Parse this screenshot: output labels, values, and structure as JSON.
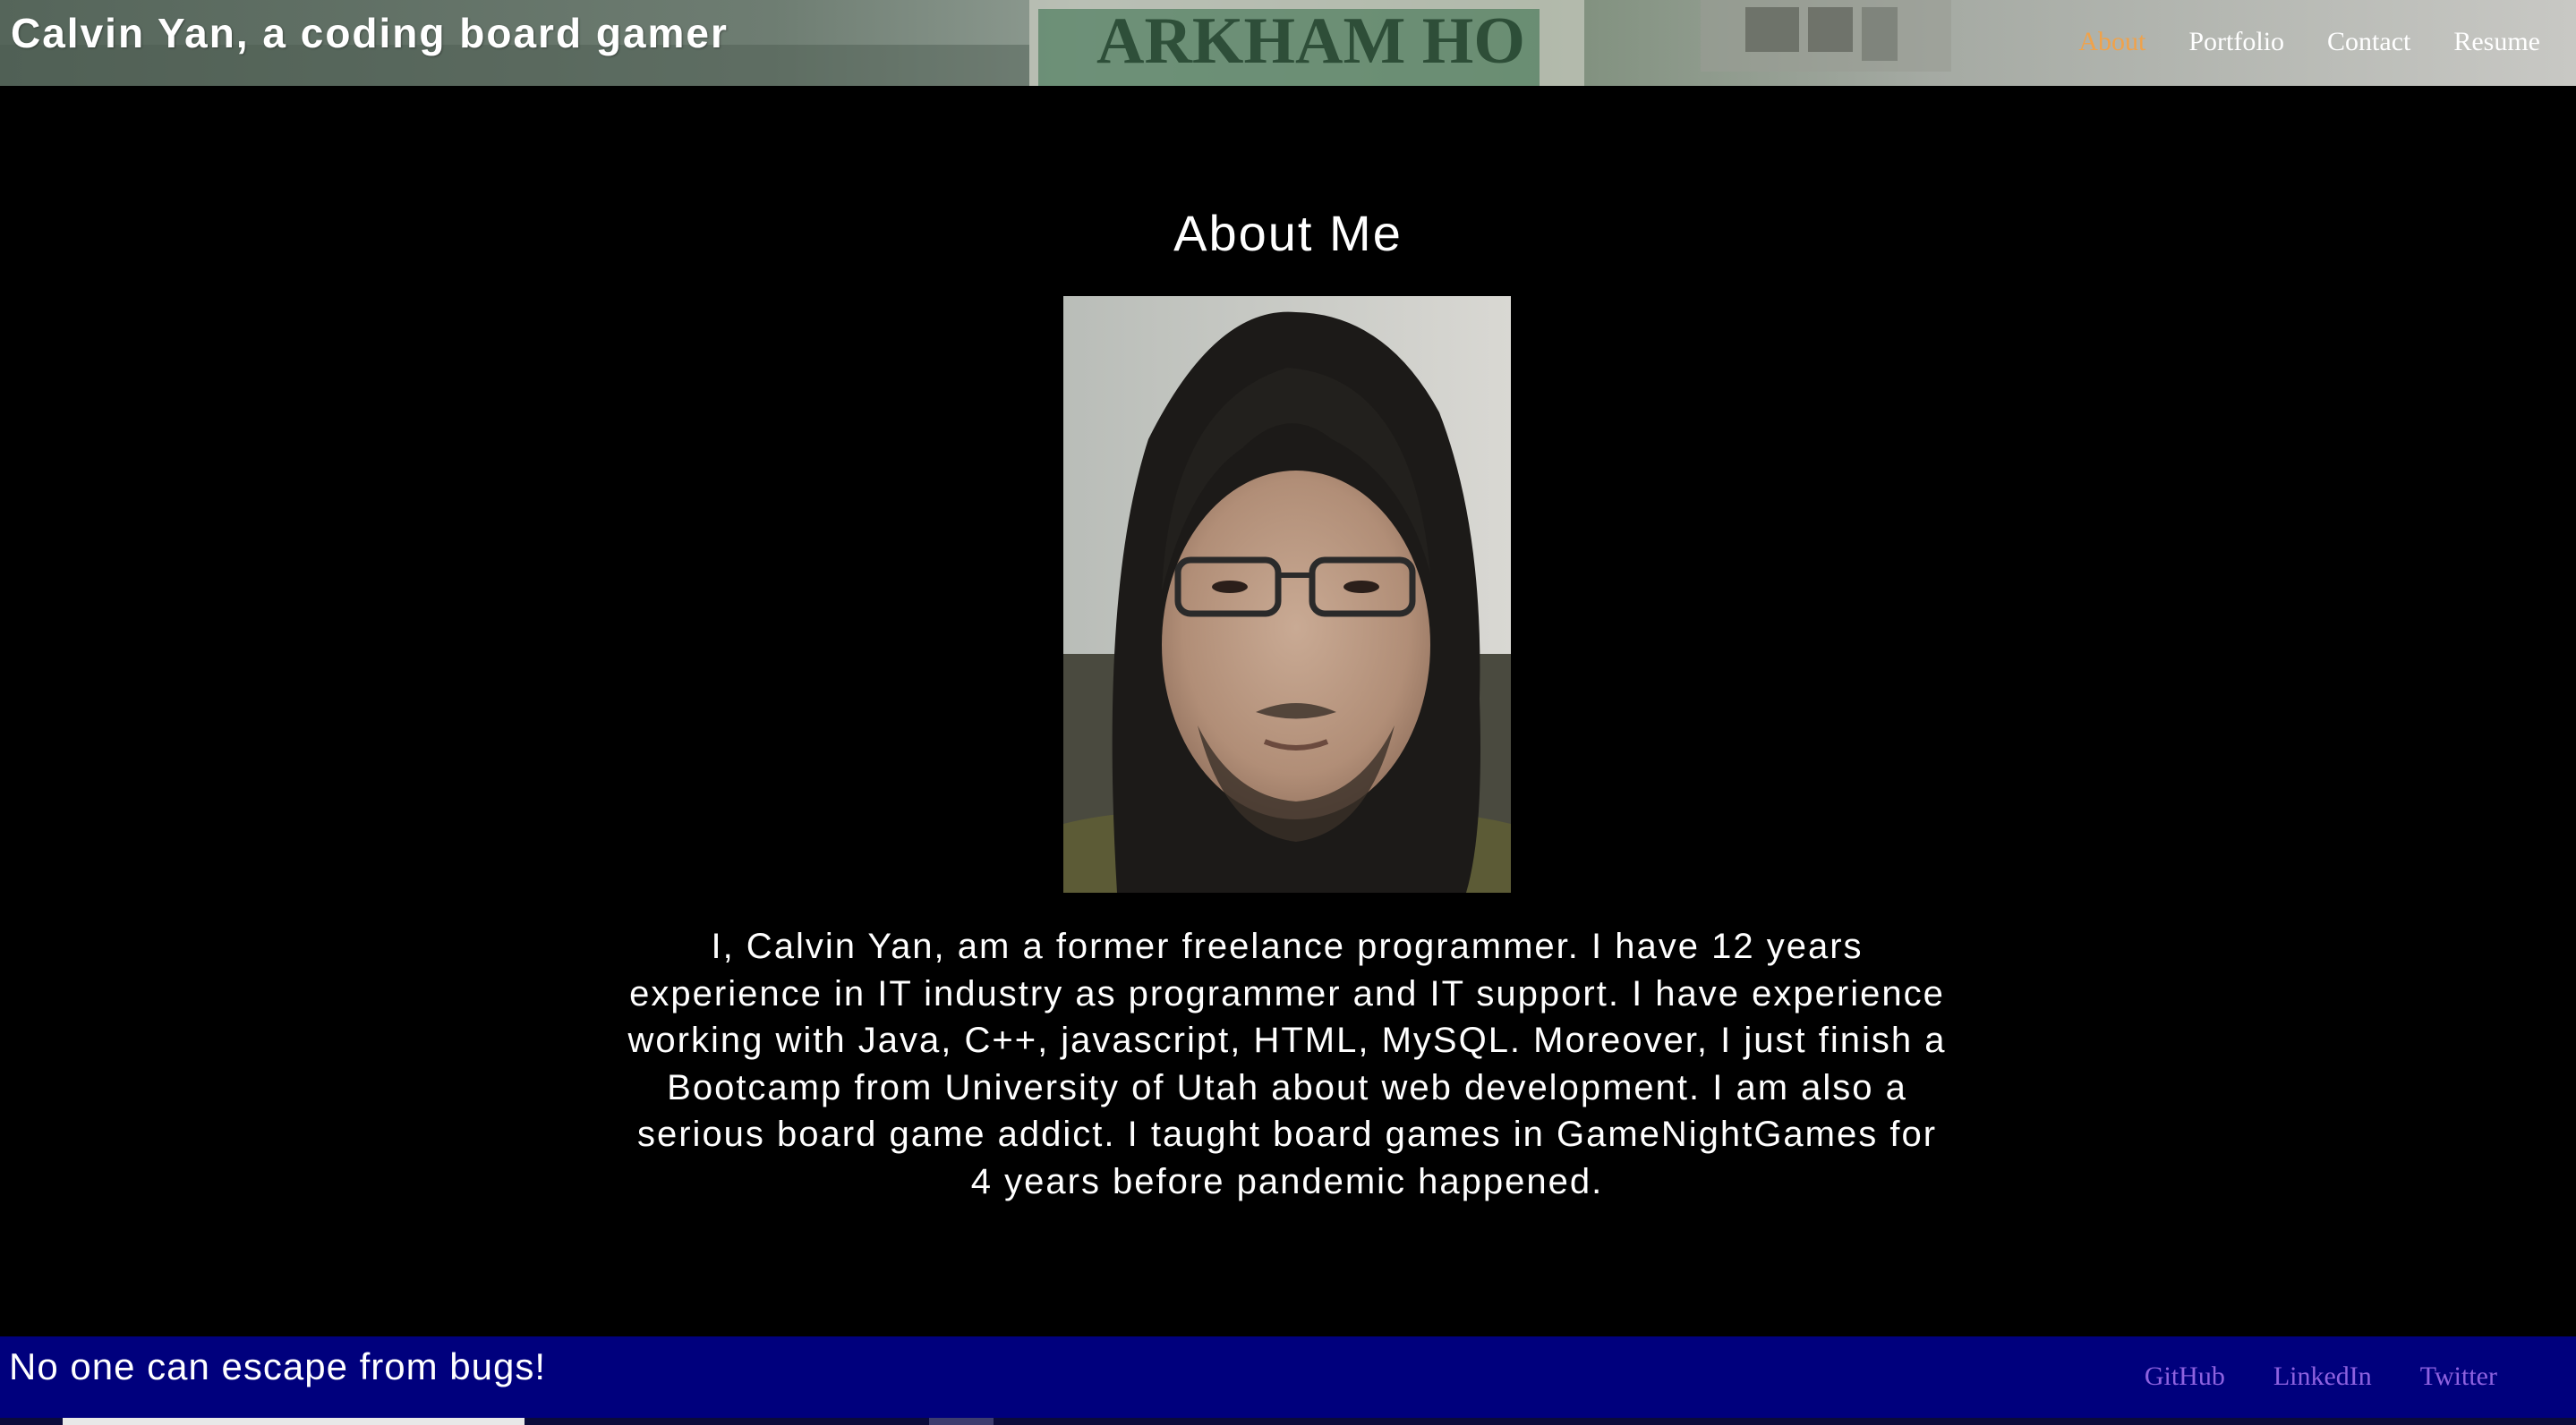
{
  "header": {
    "site_title": "Calvin Yan, a coding board gamer",
    "nav": [
      {
        "label": "About",
        "active": true
      },
      {
        "label": "Portfolio",
        "active": false
      },
      {
        "label": "Contact",
        "active": false
      },
      {
        "label": "Resume",
        "active": false
      }
    ],
    "banner_text": "ARKHAM HO"
  },
  "main": {
    "heading": "About Me",
    "portrait_icon": "portrait-photo",
    "bio": "I, Calvin Yan, am a former freelance programmer. I have 12 years experience in IT industry as programmer and IT support. I have experience working with Java, C++, javascript, HTML, MySQL. Moreover, I just finish a Bootcamp from University of Utah about web development. I am also a serious board game addict. I taught board games in GameNightGames for 4 years before pandemic happened."
  },
  "footer": {
    "tagline": "No one can escape from bugs!",
    "links": [
      "GitHub",
      "LinkedIn",
      "Twitter"
    ]
  },
  "colors": {
    "background": "#000000",
    "nav_active": "#f0a24a",
    "footer_bg": "#00007d",
    "footer_link": "#8e62e0"
  }
}
